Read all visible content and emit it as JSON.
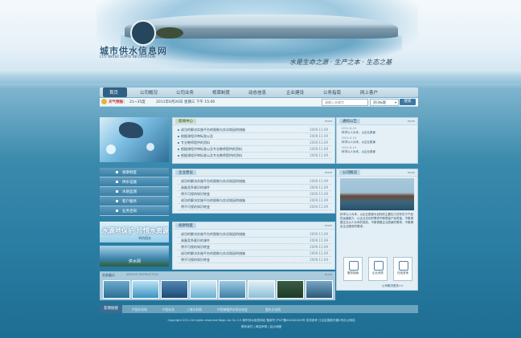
{
  "header": {
    "site_title": "城市供水信息网",
    "site_subtitle": "CITY WATER SUPPLY INFORMATION",
    "slogan": "水是生命之源 · 生产之本 · 生态之基"
  },
  "nav": {
    "items": [
      "首页",
      "公司概况",
      "公司业务",
      "规章制度",
      "动态信息",
      "企业建设",
      "公务指南",
      "网上客户"
    ]
  },
  "infobar": {
    "weather_label": "天气预报：",
    "weather": "21~35度",
    "date": "2011年6月20日 星期三 下午 15:00",
    "search_placeholder": "请输入关键字",
    "search_select": "资讯标题",
    "search_button": "搜索"
  },
  "sidebar": {
    "items": [
      "规章制度",
      "供水设施",
      "水质监测",
      "客户服务",
      "业务咨询"
    ],
    "ad1_left": "水源地保护",
    "ad1_right": "珍惜水资源",
    "ad1_caption": "节约用水",
    "ad2_caption": "供水网"
  },
  "news": {
    "title": "新闻中心",
    "more": "more",
    "items": [
      {
        "text": "成功的解决实施平台的限制与实试效因的措施",
        "date": "2009.11.09"
      },
      {
        "text": "根据课程评审标准以及",
        "date": "2009.11.09"
      },
      {
        "text": "专业教师提供的资料",
        "date": "2009.11.09"
      },
      {
        "text": "根据课程评审标准以及专业教师提供的资料",
        "date": "2009.11.09"
      },
      {
        "text": "根据课程评审标准以及专业教师提供的资料",
        "date": "2009.11.09"
      }
    ]
  },
  "notice": {
    "title": "通知公告",
    "more": "more",
    "items": [
      {
        "date": "2011-6-19",
        "text": "科学以人为本，以企业愿景"
      },
      {
        "date": "2011-6-19",
        "text": "科学以人为本，以企业愿景"
      },
      {
        "date": "2011-6-19",
        "text": "科学以人为本，以企业愿景"
      }
    ]
  },
  "corp": {
    "title": "企业建设",
    "more": "more",
    "items": [
      {
        "text": "成功的解决实施平台的限制与实试效因的措施",
        "date": "2009.11.09"
      },
      {
        "text": "具备竞争意识的课件",
        "date": "2009.11.09"
      },
      {
        "text": "将不可视的知识转变",
        "date": "2009.11.09"
      },
      {
        "text": "成功的解决实施平台的限制与实试效因的措施",
        "date": "2009.11.09"
      },
      {
        "text": "将不可视的知识转变",
        "date": "2009.11.09"
      }
    ]
  },
  "policy": {
    "title": "规章制度",
    "more": "more",
    "items": [
      {
        "text": "成功的解决实施平台的限制与实试效因的措施",
        "date": "2009.11.09"
      },
      {
        "text": "具备竞争意识的课件",
        "date": "2009.11.09"
      },
      {
        "text": "将不可视的知识转变",
        "date": "2009.11.09"
      },
      {
        "text": "成功的解决实施平台的限制与实试效因的措施",
        "date": "2009.11.09"
      },
      {
        "text": "将不可视的知识转变",
        "date": "2009.11.09"
      }
    ]
  },
  "profile": {
    "title": "公司概况",
    "more": "more",
    "text": "科学以人为本，以企业愿景为目标的主要实力并非在于产品的运营能力，以企业文化的需求不断提高产品质量，不断调整企业以人为本的观念。不断调整企业愿景的需求，不断满足企业服务的需求。",
    "tiles": [
      "服务指南",
      "企业资质",
      "在线咨询"
    ],
    "more_link": "公司概况更多>>"
  },
  "projects": {
    "title": "业务展示",
    "subtitle": "SERVICE INSTRUCTION",
    "more": "more"
  },
  "footer": {
    "label": "友情链接",
    "links": [
      "中国水利网",
      "中国水务",
      "三峡水利网",
      "中国城镇供水排水协会",
      "重庆文化网"
    ],
    "copyright": "Copyright 2011  All rights reserved Begin by Ou 2.0   城市供水信息网站   备案号 沪ICP备XXXXXXXX号   仅供参考   江北区建新东路2号办公网站",
    "bottom_links": "联系我们 | 网站声明 | 站点地图"
  },
  "colors": {
    "nav_active": "#2f5f83",
    "panel_bg": "#ebf4f9",
    "page_water": "#2b7ea3"
  }
}
